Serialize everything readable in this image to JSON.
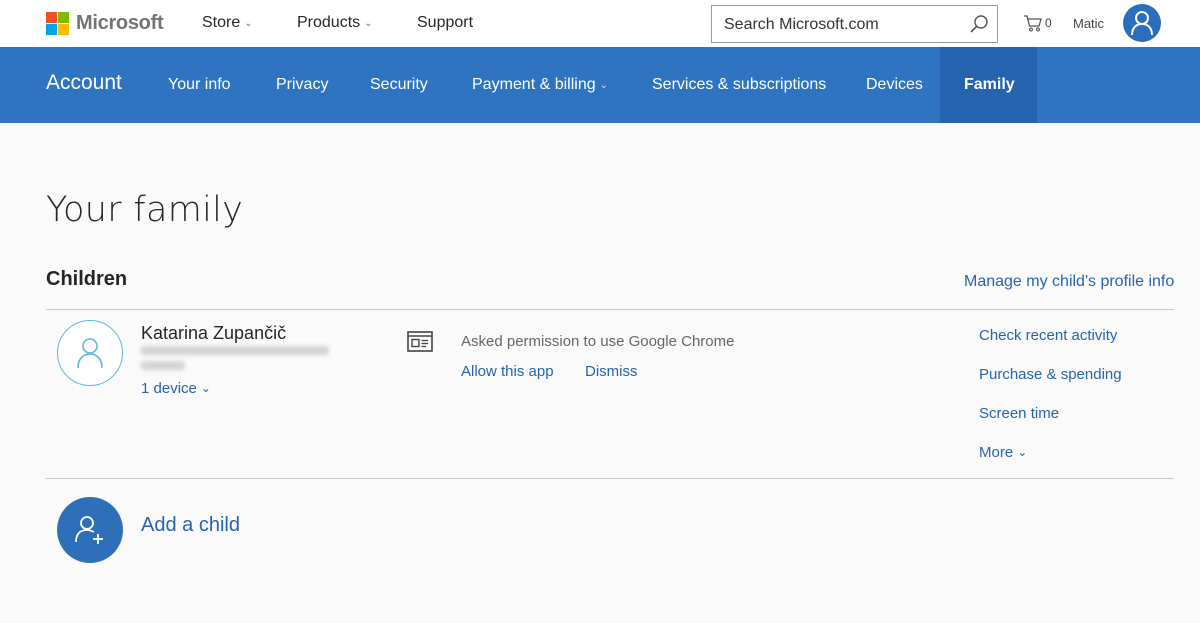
{
  "header": {
    "brand": "Microsoft",
    "brand_colors": [
      "#f25022",
      "#7fba00",
      "#00a4ef",
      "#ffb900"
    ],
    "nav": [
      {
        "label": "Store",
        "has_dropdown": true
      },
      {
        "label": "Products",
        "has_dropdown": true
      },
      {
        "label": "Support",
        "has_dropdown": false
      }
    ],
    "search_placeholder": "Search Microsoft.com",
    "cart_count": "0",
    "user_name": "Matic"
  },
  "account_nav": {
    "title": "Account",
    "items": [
      {
        "label": "Your info"
      },
      {
        "label": "Privacy"
      },
      {
        "label": "Security"
      },
      {
        "label": "Payment & billing",
        "has_dropdown": true
      },
      {
        "label": "Services & subscriptions"
      },
      {
        "label": "Devices"
      },
      {
        "label": "Family",
        "active": true
      }
    ],
    "bar_color": "#2e74c0",
    "active_color": "#2563ad"
  },
  "main": {
    "title": "Your family",
    "children_heading": "Children",
    "manage_link": "Manage my child's profile info",
    "child": {
      "name": "Katarina Zupančič",
      "devices": "1 device",
      "request": "Asked permission to use Google Chrome",
      "allow": "Allow this app",
      "dismiss": "Dismiss",
      "actions": [
        "Check recent activity",
        "Purchase & spending",
        "Screen time",
        "More"
      ]
    },
    "add_child": "Add a child"
  }
}
